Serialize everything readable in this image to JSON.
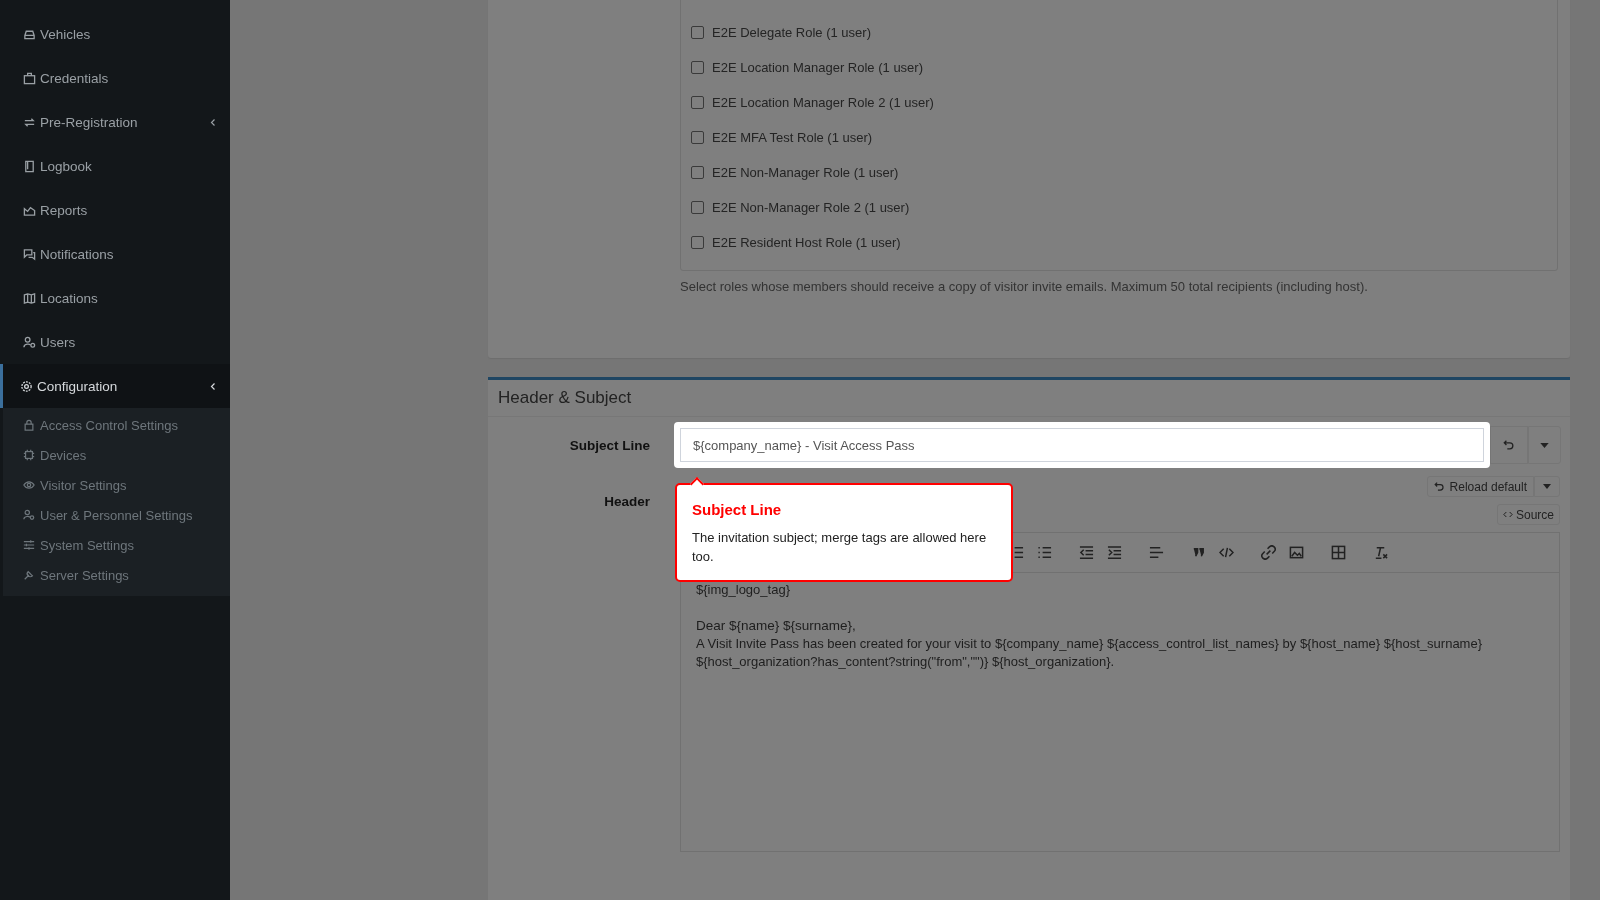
{
  "sidebar": {
    "items": [
      {
        "label": "Vehicles",
        "selected": false,
        "expandable": false
      },
      {
        "label": "Credentials",
        "selected": false,
        "expandable": false
      },
      {
        "label": "Pre-Registration",
        "selected": false,
        "expandable": true
      },
      {
        "label": "Logbook",
        "selected": false,
        "expandable": false
      },
      {
        "label": "Reports",
        "selected": false,
        "expandable": false
      },
      {
        "label": "Notifications",
        "selected": false,
        "expandable": false
      },
      {
        "label": "Locations",
        "selected": false,
        "expandable": false
      },
      {
        "label": "Users",
        "selected": false,
        "expandable": false
      },
      {
        "label": "Configuration",
        "selected": true,
        "expandable": true,
        "children": [
          {
            "label": "Access Control Settings"
          },
          {
            "label": "Devices"
          },
          {
            "label": "Visitor Settings"
          },
          {
            "label": "User & Personnel Settings"
          },
          {
            "label": "System Settings"
          },
          {
            "label": "Server Settings"
          }
        ]
      }
    ]
  },
  "roles": {
    "items": [
      {
        "label": "E2E Delegate Role (1 user)",
        "checked": false
      },
      {
        "label": "E2E Location Manager Role (1 user)",
        "checked": false
      },
      {
        "label": "E2E Location Manager Role 2 (1 user)",
        "checked": false
      },
      {
        "label": "E2E MFA Test Role (1 user)",
        "checked": false
      },
      {
        "label": "E2E Non-Manager Role (1 user)",
        "checked": false
      },
      {
        "label": "E2E Non-Manager Role 2 (1 user)",
        "checked": false
      },
      {
        "label": "E2E Resident Host Role (1 user)",
        "checked": false
      }
    ],
    "hint": "Select roles whose members should receive a copy of visitor invite emails. Maximum 50 total recipients (including host)."
  },
  "header_subject": {
    "title": "Header & Subject",
    "subject_label": "Subject Line",
    "subject_value": "${company_name} - Visit Access Pass",
    "header_label": "Header",
    "reload_button": "Reload default",
    "source_button": "Source",
    "editor_lines": [
      "${img_logo_tag}",
      "Dear ${name} ${surname},",
      "A Visit Invite Pass has been created for your visit to ${company_name} ${access_control_list_names} by ${host_name} ${host_surname} ${host_organization?has_content?string(\"from\",\"\")} ${host_organization}."
    ]
  },
  "tooltip": {
    "title": "Subject Line",
    "body": "The invitation subject; merge tags are allowed here too."
  }
}
